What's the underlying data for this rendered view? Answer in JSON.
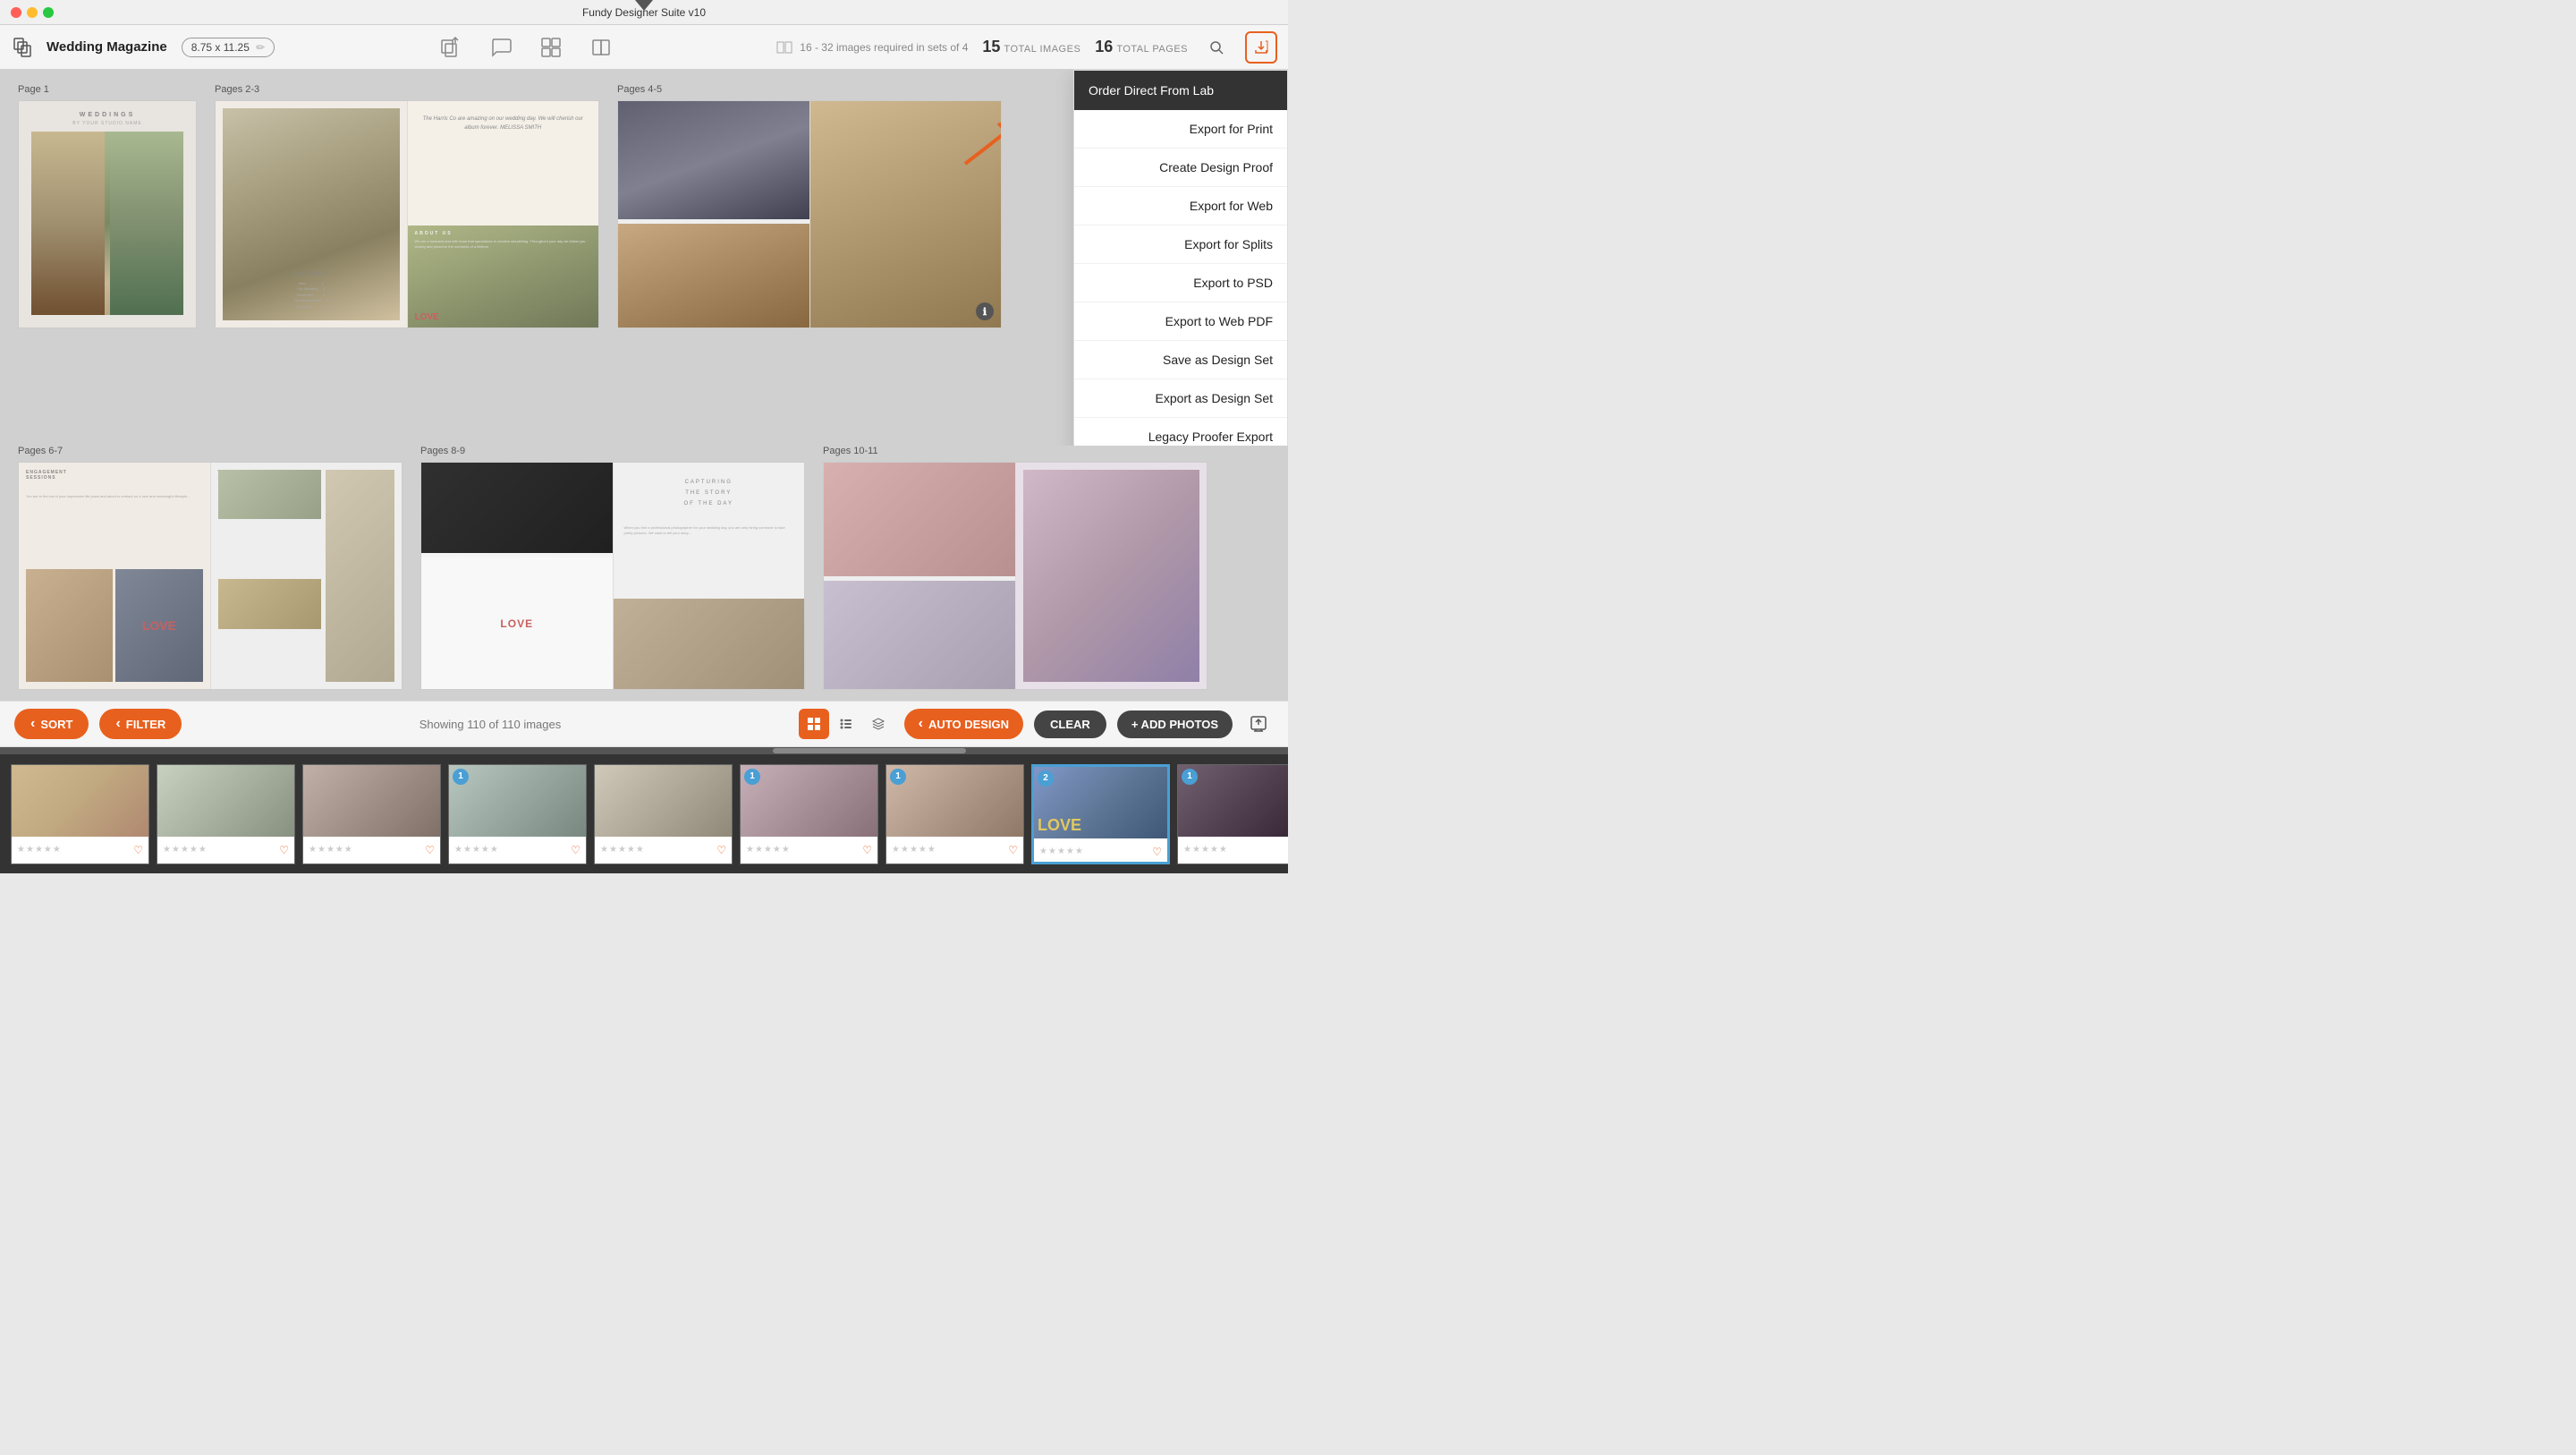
{
  "app": {
    "title": "Fundy Designer Suite v10"
  },
  "titlebar": {
    "close": "close",
    "minimize": "minimize",
    "maximize": "maximize"
  },
  "toolbar": {
    "project_name": "Wedding Magazine",
    "size_label": "8.75 x 11.25",
    "images_req": "16 - 32 images required in sets of 4",
    "total_images_num": "15",
    "total_images_label": "TOTAL IMAGES",
    "total_pages_num": "16",
    "total_pages_label": "TOTAL PAGES"
  },
  "export_menu": {
    "order_label": "Order Direct From Lab",
    "items": [
      "Export for Print",
      "Create Design Proof",
      "Export for Web",
      "Export for Splits",
      "Export to PSD",
      "Export to Web PDF",
      "Save as Design Set",
      "Export as Design Set",
      "Legacy Proofer Export"
    ]
  },
  "pages": [
    {
      "label": "Page 1"
    },
    {
      "label": "Pages 2-3"
    },
    {
      "label": "Pages 4-5"
    },
    {
      "label": "Pages 6-7"
    },
    {
      "label": "Pages 8-9"
    },
    {
      "label": "Pages 10-11"
    }
  ],
  "bottom_controls": {
    "sort_label": "SORT",
    "filter_label": "FILTER",
    "showing_text": "Showing 110 of 110 images",
    "auto_design_label": "AUTO DESIGN",
    "clear_label": "CLEAR",
    "add_photos_label": "+ ADD PHOTOS"
  },
  "photo_strip": {
    "items": [
      {
        "id": 1,
        "badge": null,
        "selected": false
      },
      {
        "id": 2,
        "badge": null,
        "selected": false
      },
      {
        "id": 3,
        "badge": null,
        "selected": false
      },
      {
        "id": 4,
        "badge": "1",
        "selected": false
      },
      {
        "id": 5,
        "badge": null,
        "selected": false
      },
      {
        "id": 6,
        "badge": "1",
        "selected": false
      },
      {
        "id": 7,
        "badge": "1",
        "selected": false
      },
      {
        "id": 8,
        "badge": "2",
        "selected": true
      },
      {
        "id": 9,
        "badge": "1",
        "selected": false
      }
    ]
  }
}
